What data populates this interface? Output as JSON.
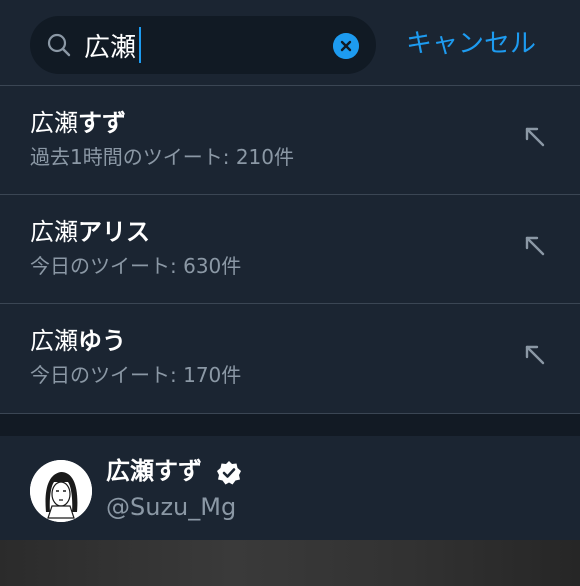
{
  "search": {
    "value": "広瀬",
    "placeholder": "",
    "cancel_label": "キャンセル",
    "accent": "#1d9bf0"
  },
  "icons": {
    "search": "search-icon",
    "clear": "clear-icon",
    "fill": "arrow-up-left-icon",
    "verified": "verified-badge-icon"
  },
  "suggestions": [
    {
      "base": "広瀬",
      "rest": "すず",
      "sub": "過去1時間のツイート: 210件"
    },
    {
      "base": "広瀬",
      "rest": "アリス",
      "sub": "今日のツイート: 630件"
    },
    {
      "base": "広瀬",
      "rest": "ゆう",
      "sub": "今日のツイート: 170件"
    }
  ],
  "user": {
    "name": "広瀬すず",
    "handle": "@Suzu_Mg",
    "verified": true
  }
}
